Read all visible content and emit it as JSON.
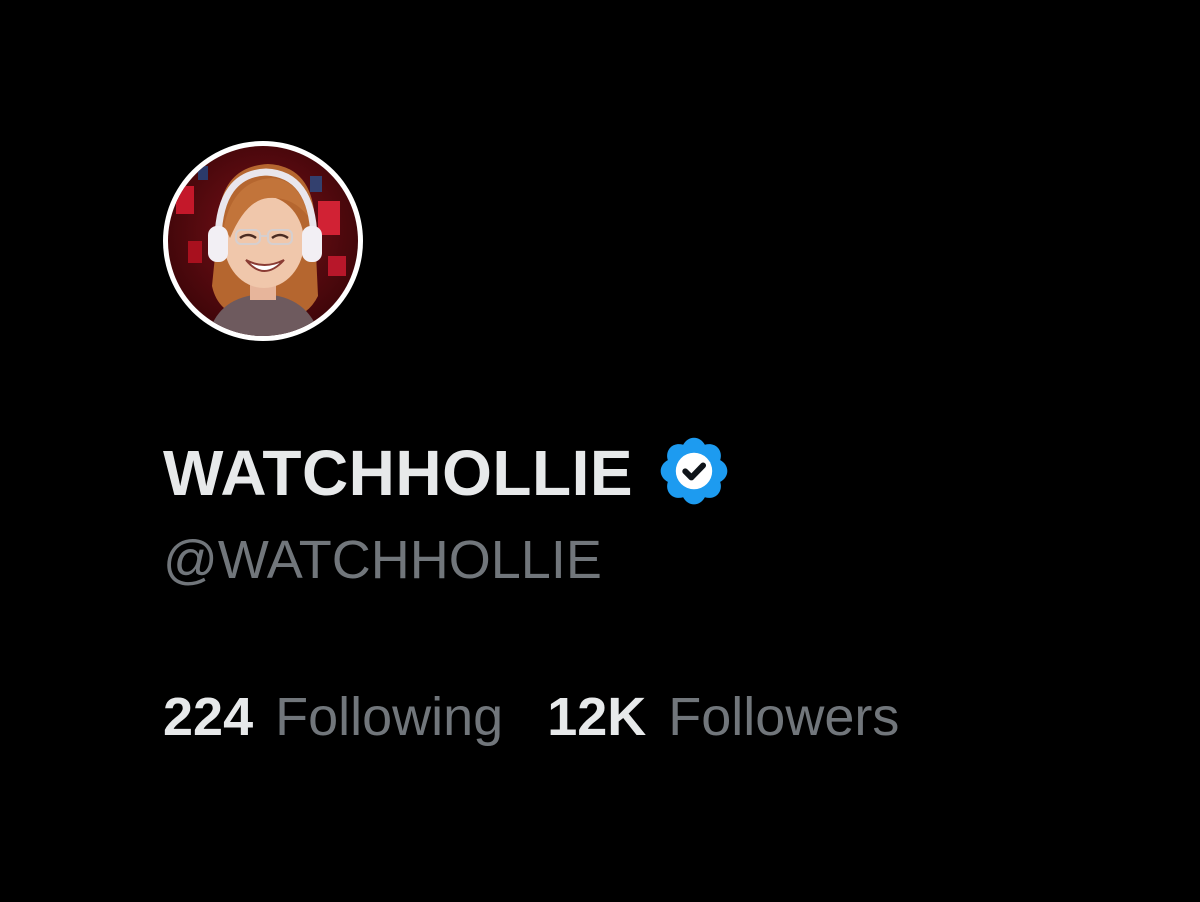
{
  "profile": {
    "display_name": "WATCHHOLLIE",
    "handle": "@WATCHHOLLIE",
    "verified_icon": "verified-badge-icon",
    "avatar_icon": "avatar-portrait",
    "following_count": "224",
    "following_label": "Following",
    "followers_count": "12K",
    "followers_label": "Followers"
  },
  "colors": {
    "background": "#000000",
    "primary_text": "#e7e9ea",
    "secondary_text": "#71767b",
    "verified_blue": "#1d9bf0"
  }
}
